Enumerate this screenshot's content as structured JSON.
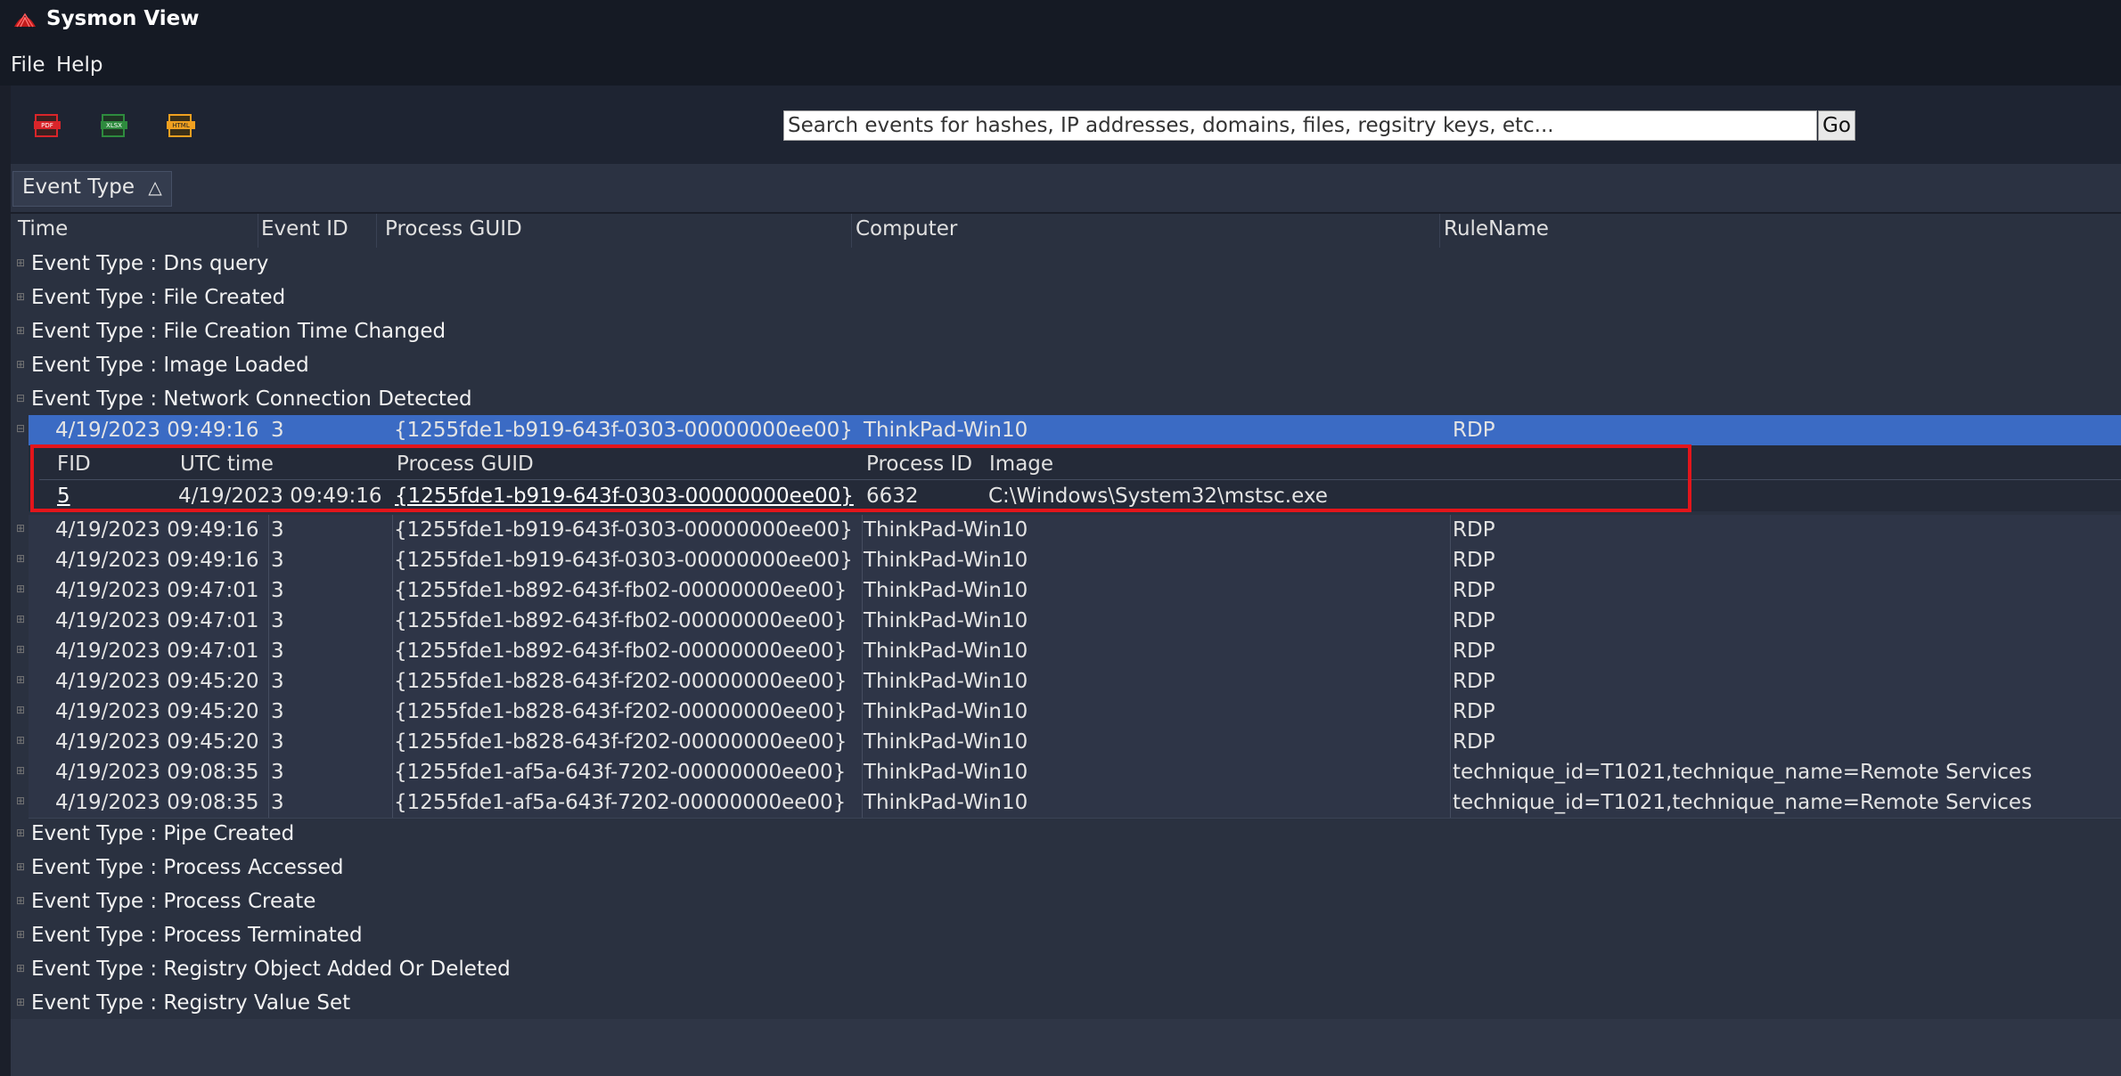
{
  "app": {
    "title": "Sysmon View"
  },
  "menu": {
    "file": "File",
    "help": "Help"
  },
  "toolbar": {
    "buttons": [
      {
        "name": "pdf-export-icon",
        "label": "PDF",
        "color": "#d9252a"
      },
      {
        "name": "xlsx-export-icon",
        "label": "XLSX",
        "color": "#2e8b3e"
      },
      {
        "name": "html-export-icon",
        "label": "HTML",
        "color": "#f0a020"
      }
    ],
    "search_placeholder": "Search events for hashes, IP addresses, domains, files, regsitry keys, etc...",
    "go_label": "Go"
  },
  "grouping": {
    "chip_label": "Event Type",
    "chip_sort_glyph": "△"
  },
  "columns": [
    "Time",
    "Event ID",
    "Process GUID",
    "Computer",
    "RuleName"
  ],
  "groups_before": [
    "Event Type : Dns query",
    "Event Type : File Created",
    "Event Type : File Creation Time Changed",
    "Event Type : Image Loaded",
    "Event Type : Network Connection Detected"
  ],
  "selected_row": {
    "time": "4/19/2023 09:49:16",
    "event_id": "3",
    "guid": "{1255fde1-b919-643f-0303-00000000ee00}",
    "computer": "ThinkPad-Win10",
    "rule": "RDP"
  },
  "detail": {
    "headers": [
      "FID",
      "UTC time",
      "Process GUID",
      "Process ID",
      "Image"
    ],
    "values": {
      "fid": "5",
      "utc_time": "4/19/2023 09:49:16",
      "guid": "{1255fde1-b919-643f-0303-00000000ee00}",
      "pid": "6632",
      "image": "C:\\Windows\\System32\\mstsc.exe"
    }
  },
  "rows": [
    {
      "time": "4/19/2023 09:49:16",
      "event_id": "3",
      "guid": "{1255fde1-b919-643f-0303-00000000ee00}",
      "computer": "ThinkPad-Win10",
      "rule": "RDP"
    },
    {
      "time": "4/19/2023 09:49:16",
      "event_id": "3",
      "guid": "{1255fde1-b919-643f-0303-00000000ee00}",
      "computer": "ThinkPad-Win10",
      "rule": "RDP"
    },
    {
      "time": "4/19/2023 09:47:01",
      "event_id": "3",
      "guid": "{1255fde1-b892-643f-fb02-00000000ee00}",
      "computer": "ThinkPad-Win10",
      "rule": "RDP"
    },
    {
      "time": "4/19/2023 09:47:01",
      "event_id": "3",
      "guid": "{1255fde1-b892-643f-fb02-00000000ee00}",
      "computer": "ThinkPad-Win10",
      "rule": "RDP"
    },
    {
      "time": "4/19/2023 09:47:01",
      "event_id": "3",
      "guid": "{1255fde1-b892-643f-fb02-00000000ee00}",
      "computer": "ThinkPad-Win10",
      "rule": "RDP"
    },
    {
      "time": "4/19/2023 09:45:20",
      "event_id": "3",
      "guid": "{1255fde1-b828-643f-f202-00000000ee00}",
      "computer": "ThinkPad-Win10",
      "rule": "RDP"
    },
    {
      "time": "4/19/2023 09:45:20",
      "event_id": "3",
      "guid": "{1255fde1-b828-643f-f202-00000000ee00}",
      "computer": "ThinkPad-Win10",
      "rule": "RDP"
    },
    {
      "time": "4/19/2023 09:45:20",
      "event_id": "3",
      "guid": "{1255fde1-b828-643f-f202-00000000ee00}",
      "computer": "ThinkPad-Win10",
      "rule": "RDP"
    },
    {
      "time": "4/19/2023 09:08:35",
      "event_id": "3",
      "guid": "{1255fde1-af5a-643f-7202-00000000ee00}",
      "computer": "ThinkPad-Win10",
      "rule": "technique_id=T1021,technique_name=Remote Services"
    },
    {
      "time": "4/19/2023 09:08:35",
      "event_id": "3",
      "guid": "{1255fde1-af5a-643f-7202-00000000ee00}",
      "computer": "ThinkPad-Win10",
      "rule": "technique_id=T1021,technique_name=Remote Services"
    }
  ],
  "groups_after": [
    "Event Type : Pipe Created",
    "Event Type : Process Accessed",
    "Event Type : Process Create",
    "Event Type : Process Terminated",
    "Event Type : Registry Object Added Or Deleted",
    "Event Type : Registry Value Set"
  ]
}
